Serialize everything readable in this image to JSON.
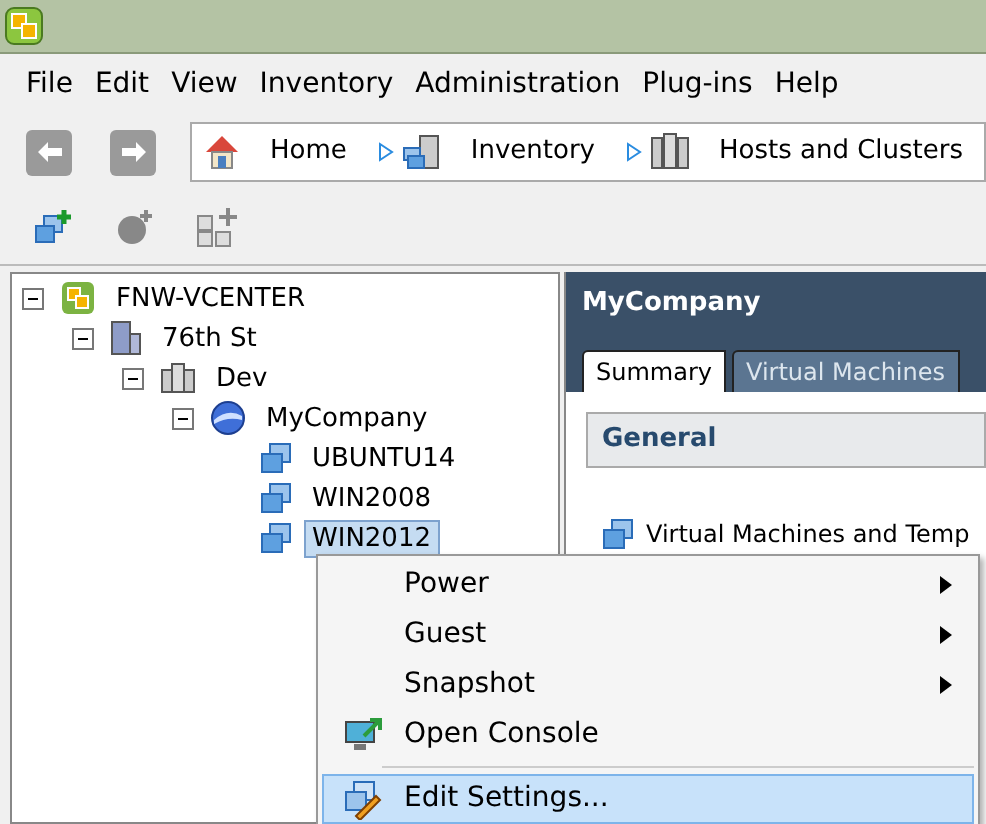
{
  "menu_bar": [
    "File",
    "Edit",
    "View",
    "Inventory",
    "Administration",
    "Plug-ins",
    "Help"
  ],
  "breadcrumb": [
    {
      "label": "Home",
      "kind": "home"
    },
    {
      "label": "Inventory",
      "kind": "inventory"
    },
    {
      "label": "Hosts and Clusters",
      "kind": "hosts"
    }
  ],
  "tree": [
    {
      "label": "FNW-VCENTER",
      "kind": "vcenter",
      "expanded": true,
      "selected": false,
      "children": [
        {
          "label": "76th St",
          "kind": "datacenter",
          "expanded": true,
          "selected": false,
          "children": [
            {
              "label": "Dev",
              "kind": "cluster",
              "expanded": true,
              "selected": false,
              "children": [
                {
                  "label": "MyCompany",
                  "kind": "pool",
                  "expanded": true,
                  "selected": false,
                  "children": [
                    {
                      "label": "UBUNTU14",
                      "kind": "vm",
                      "selected": false
                    },
                    {
                      "label": "WIN2008",
                      "kind": "vm",
                      "selected": false
                    },
                    {
                      "label": "WIN2012",
                      "kind": "vm",
                      "selected": true
                    }
                  ]
                }
              ]
            }
          ]
        }
      ]
    }
  ],
  "detail": {
    "title": "MyCompany",
    "tabs": [
      {
        "label": "Summary",
        "selected": true
      },
      {
        "label": "Virtual Machines",
        "selected": false
      }
    ],
    "section": "General",
    "item": "Virtual Machines and Temp"
  },
  "context_menu": [
    {
      "label": "Power",
      "kind": "submenu",
      "selected": false
    },
    {
      "label": "Guest",
      "kind": "submenu",
      "selected": false
    },
    {
      "label": "Snapshot",
      "kind": "submenu",
      "selected": false
    },
    {
      "label": "Open Console",
      "kind": "console",
      "selected": false
    },
    {
      "label": "Edit Settings...",
      "kind": "settings",
      "selected": true
    }
  ]
}
